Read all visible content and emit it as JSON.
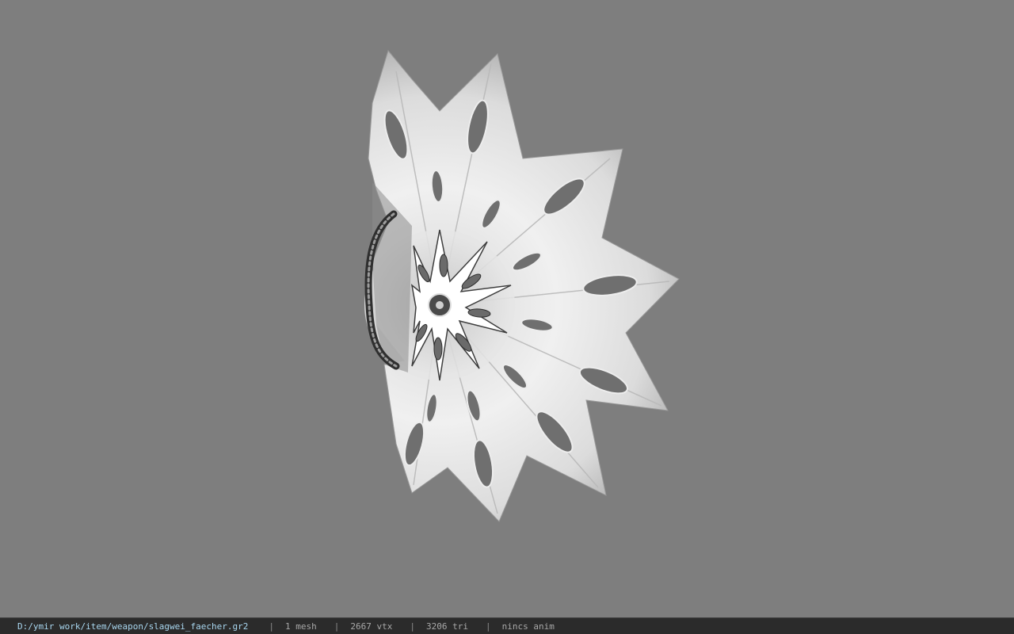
{
  "viewer": {
    "model_path": "D:/ymir work/item/weapon/slagwei_faecher.gr2",
    "separator": "|",
    "stats": [
      "1 mesh",
      "2667 vtx",
      "3206 tri",
      "nincs anim"
    ]
  },
  "colors": {
    "viewport_bg": "#7e7e7e",
    "statusbar_bg": "#2b2b2b",
    "path_text": "#a9d7f0",
    "stat_text": "#a8a8a8",
    "model_highlight": "#f2f2f2",
    "model_shadow": "#a8a8a8"
  }
}
